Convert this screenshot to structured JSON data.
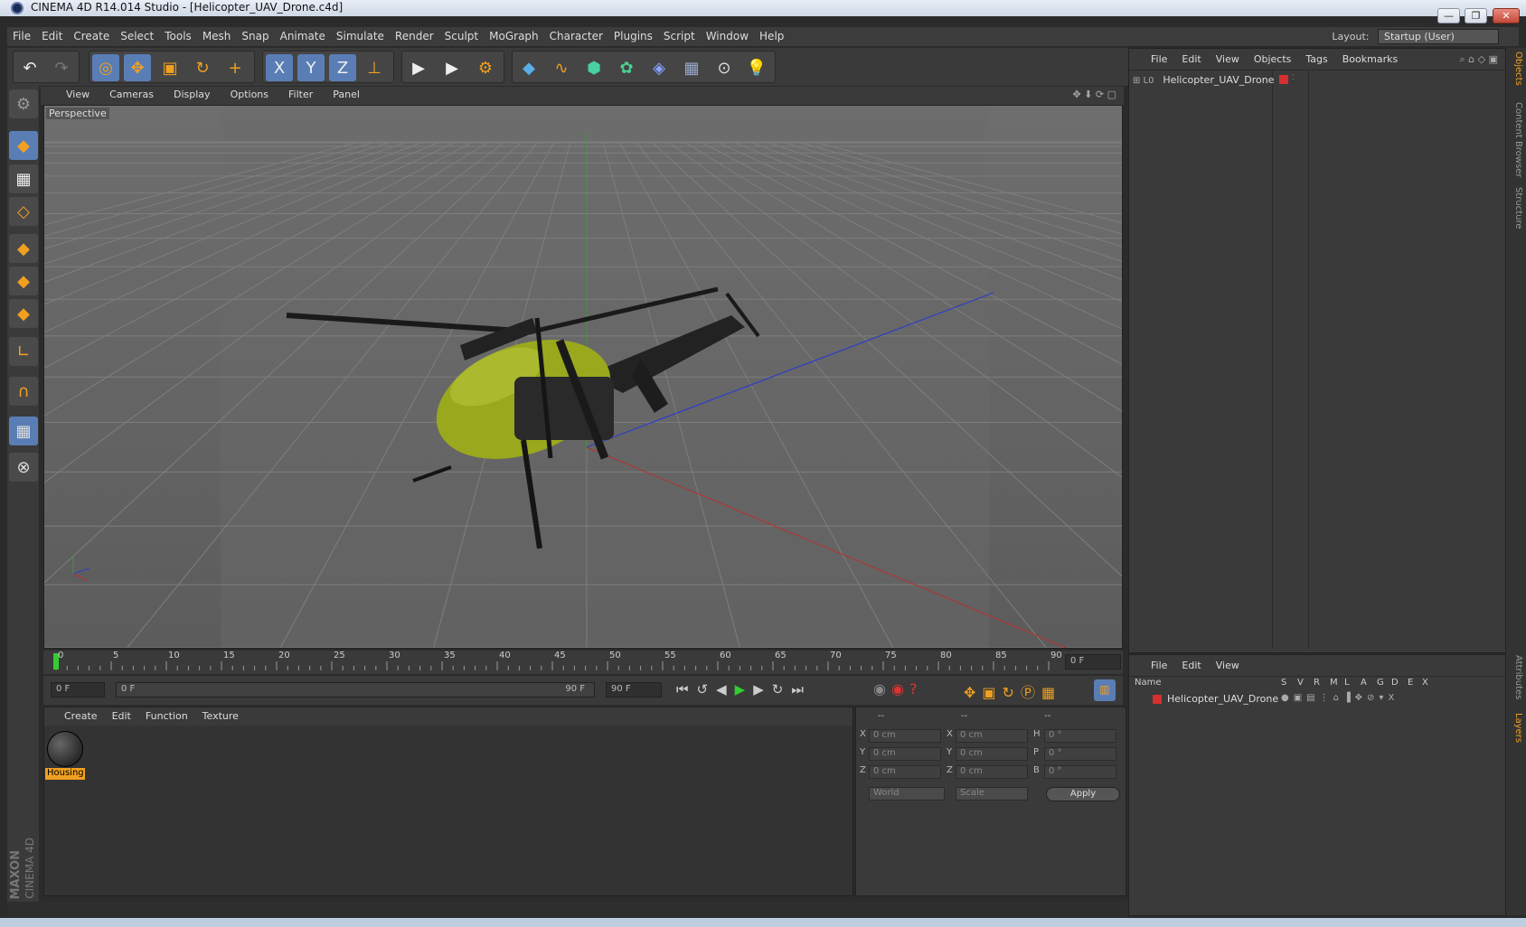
{
  "window": {
    "title": "CINEMA 4D R14.014 Studio - [Helicopter_UAV_Drone.c4d]",
    "min": "—",
    "max": "❐",
    "close": "✕"
  },
  "menu": [
    "File",
    "Edit",
    "Create",
    "Select",
    "Tools",
    "Mesh",
    "Snap",
    "Animate",
    "Simulate",
    "Render",
    "Sculpt",
    "MoGraph",
    "Character",
    "Plugins",
    "Script",
    "Window",
    "Help"
  ],
  "layout": {
    "label": "Layout:",
    "value": "Startup (User)"
  },
  "toolbar_icons": [
    "undo-icon",
    "redo-icon",
    "live-select-icon",
    "move-icon",
    "scale-icon",
    "rotate-icon",
    "add-icon",
    "x-axis-icon",
    "y-axis-icon",
    "z-axis-icon",
    "coord-system-icon",
    "render-view-icon",
    "render-picture-viewer-icon",
    "render-settings-icon",
    "cube-icon",
    "spline-icon",
    "nurbs-icon",
    "array-icon",
    "deformer-icon",
    "floor-icon",
    "camera-icon",
    "light-icon"
  ],
  "toolbar_glyphs": {
    "undo": "↶",
    "redo": "↷",
    "select": "◎",
    "move": "✥",
    "scale": "▣",
    "rotate": "↻",
    "add": "+",
    "x": "X",
    "y": "Y",
    "z": "Z",
    "coord": "⊥",
    "render1": "▶",
    "render2": "▶",
    "render3": "⚙",
    "cube": "◆",
    "spline": "∿",
    "nurbs": "⬢",
    "array": "✿",
    "deform": "◈",
    "floor": "▦",
    "camera": "⊙",
    "light": "💡"
  },
  "viewport_menu": [
    "View",
    "Cameras",
    "Display",
    "Options",
    "Filter",
    "Panel"
  ],
  "viewport": {
    "label": "Perspective"
  },
  "timeline": {
    "ticks": [
      "0",
      "5",
      "10",
      "15",
      "20",
      "25",
      "30",
      "35",
      "40",
      "45",
      "50",
      "55",
      "60",
      "65",
      "70",
      "75",
      "80",
      "85",
      "90"
    ],
    "current": "0 F"
  },
  "controls": {
    "start": "0 F",
    "range_start": "0 F",
    "range_end": "90 F",
    "end": "90 F"
  },
  "material_menu": [
    "Create",
    "Edit",
    "Function",
    "Texture"
  ],
  "material": {
    "name": "Housing"
  },
  "coords": {
    "header": [
      "--",
      "--",
      "--"
    ],
    "rows": [
      {
        "l1": "X",
        "v1": "0 cm",
        "l2": "X",
        "v2": "0 cm",
        "l3": "H",
        "v3": "0 °"
      },
      {
        "l1": "Y",
        "v1": "0 cm",
        "l2": "Y",
        "v2": "0 cm",
        "l3": "P",
        "v3": "0 °"
      },
      {
        "l1": "Z",
        "v1": "0 cm",
        "l2": "Z",
        "v2": "0 cm",
        "l3": "B",
        "v3": "0 °"
      }
    ],
    "world": "World",
    "scale": "Scale",
    "apply": "Apply"
  },
  "objects_menu": [
    "File",
    "Edit",
    "View",
    "Objects",
    "Tags",
    "Bookmarks"
  ],
  "object": {
    "name": "Helicopter_UAV_Drone"
  },
  "layers_menu": [
    "File",
    "Edit",
    "View"
  ],
  "layers": {
    "columns": [
      "Name",
      "S",
      "V",
      "R",
      "M",
      "L",
      "A",
      "G",
      "D",
      "E",
      "X"
    ],
    "name": "Helicopter_UAV_Drone"
  },
  "side_tabs": [
    "Objects",
    "Content Browser",
    "Structure"
  ],
  "side_tabs_bottom": [
    "Attributes",
    "Layers"
  ],
  "brand": {
    "line1": "MAXON",
    "line2": "CINEMA 4D"
  },
  "colors": {
    "accent": "#5a7db5",
    "drone_body": "#9aa81e",
    "object_tag": "#d43030"
  }
}
